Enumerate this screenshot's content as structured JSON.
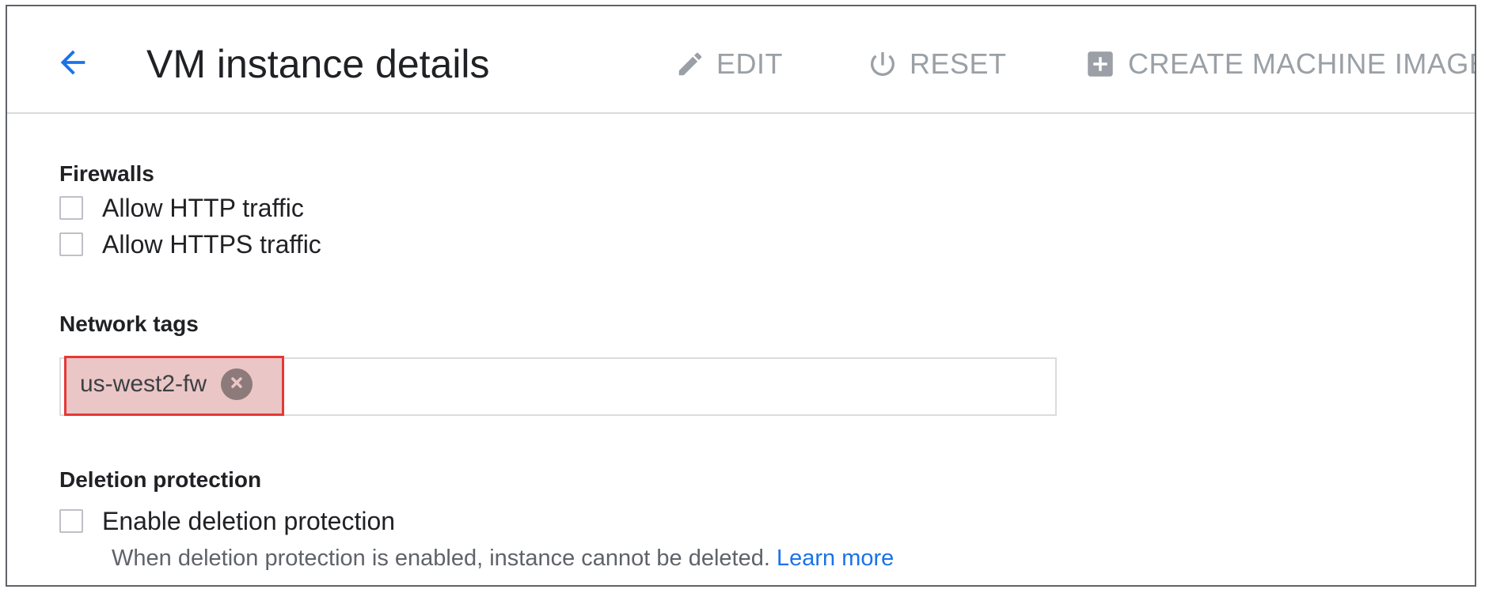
{
  "header": {
    "title": "VM instance details",
    "back_icon": "arrow-back-icon",
    "actions": {
      "edit": {
        "label": "EDIT",
        "icon": "pencil-icon"
      },
      "reset": {
        "label": "RESET",
        "icon": "power-icon"
      },
      "create_image": {
        "label": "CREATE MACHINE IMAGE",
        "icon": "add-box-icon"
      }
    }
  },
  "firewalls": {
    "title": "Firewalls",
    "options": [
      {
        "label": "Allow HTTP traffic",
        "checked": false
      },
      {
        "label": "Allow HTTPS traffic",
        "checked": false
      }
    ]
  },
  "network_tags": {
    "title": "Network tags",
    "tags": [
      "us-west2-fw"
    ]
  },
  "deletion_protection": {
    "title": "Deletion protection",
    "option_label": "Enable deletion protection",
    "checked": false,
    "help_text": "When deletion protection is enabled, instance cannot be deleted.",
    "learn_more": "Learn more"
  },
  "colors": {
    "accent_blue": "#1a73e8",
    "disabled_action": "#9aa0a6",
    "highlight_border": "#e53935",
    "chip_highlight_fill": "#ebc6c6"
  }
}
